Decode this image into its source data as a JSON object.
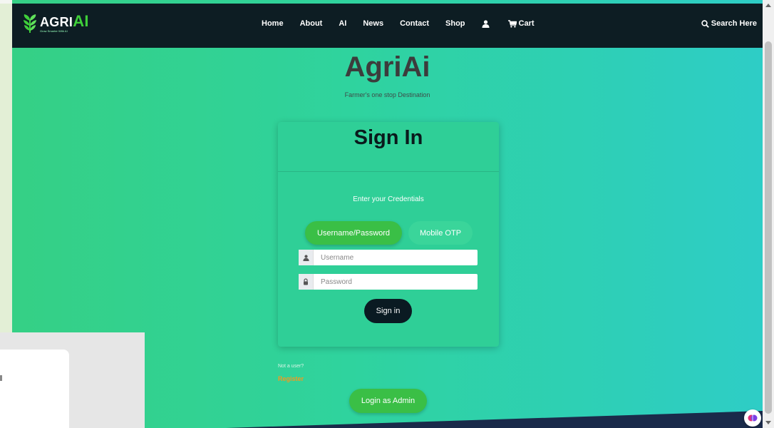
{
  "brand": {
    "logo_name_prefix": "AGRI",
    "logo_name_suffix": "AI",
    "logo_tagline": "Grow Smarter With AI",
    "title": "AgriAi",
    "subtitle": "Farmer's one stop Destination"
  },
  "nav": {
    "items": [
      {
        "label": "Home"
      },
      {
        "label": "About"
      },
      {
        "label": "AI"
      },
      {
        "label": "News"
      },
      {
        "label": "Contact"
      },
      {
        "label": "Shop"
      }
    ],
    "cart_label": "Cart",
    "search_label": "Search Here"
  },
  "signin": {
    "title": "Sign In",
    "instructions": "Enter your Credentials",
    "tabs": [
      {
        "label": "Username/Password",
        "active": true
      },
      {
        "label": "Mobile OTP",
        "active": false
      }
    ],
    "username_placeholder": "Username",
    "password_placeholder": "Password",
    "submit_label": "Sign in"
  },
  "register": {
    "prompt": "Not a user?",
    "link_label": "Register"
  },
  "admin_button_label": "Login as Admin",
  "icons": {
    "user": "user-icon",
    "cart": "cart-icon",
    "search": "search-icon",
    "lock": "lock-icon",
    "logo": "leaf-logo-icon"
  },
  "colors": {
    "navbar": "#0d1d23",
    "gradient_start": "#35d085",
    "gradient_end": "#2ecdc6",
    "primary_green": "#3abf46",
    "secondary_teal": "#3ad59a",
    "dark_button": "#0a1a22",
    "register_orange": "#f29a20",
    "title_dark": "#3c3c3c"
  }
}
